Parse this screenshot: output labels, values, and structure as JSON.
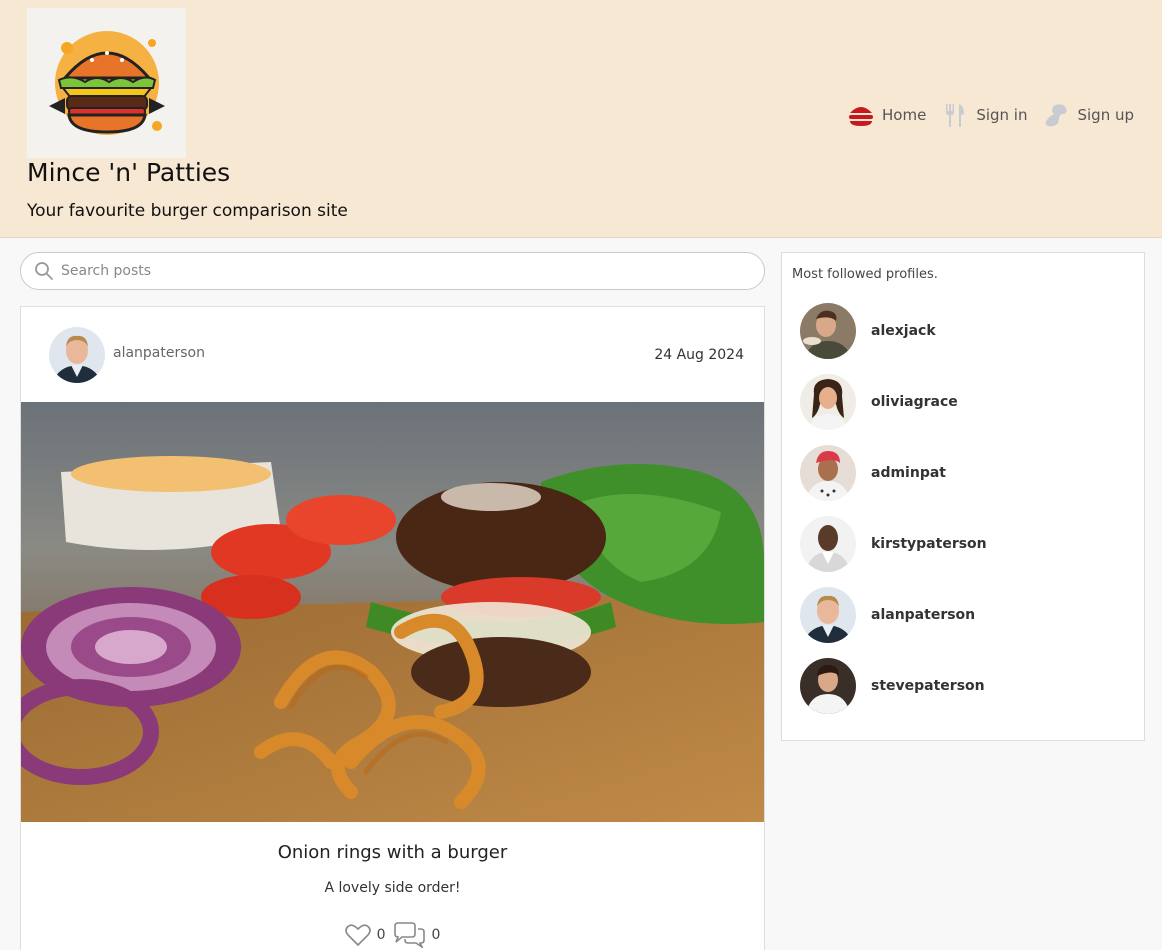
{
  "header": {
    "site_title": "Mince 'n' Patties",
    "tagline": "Your favourite burger comparison site",
    "logo_icon": "burger-logo-icon"
  },
  "nav": {
    "items": [
      {
        "label": "Home",
        "icon": "burger-icon",
        "color": "#c8181e"
      },
      {
        "label": "Sign in",
        "icon": "utensils-icon",
        "color": "#c8ccd2"
      },
      {
        "label": "Sign up",
        "icon": "chef-icon",
        "color": "#c8ccd2"
      }
    ]
  },
  "search": {
    "placeholder": "Search posts",
    "value": ""
  },
  "post": {
    "author": "alanpaterson",
    "date": "24 Aug 2024",
    "title": "Onion rings with a burger",
    "text": "A lovely side order!",
    "likes": "0",
    "comments": "0"
  },
  "sidebar": {
    "heading": "Most followed profiles.",
    "profiles": [
      {
        "name": "alexjack"
      },
      {
        "name": "oliviagrace"
      },
      {
        "name": "adminpat"
      },
      {
        "name": "kirstypaterson"
      },
      {
        "name": "alanpaterson"
      },
      {
        "name": "stevepaterson"
      }
    ]
  },
  "colors": {
    "header_bg": "#f7e8d3",
    "accent_red": "#c8181e"
  }
}
